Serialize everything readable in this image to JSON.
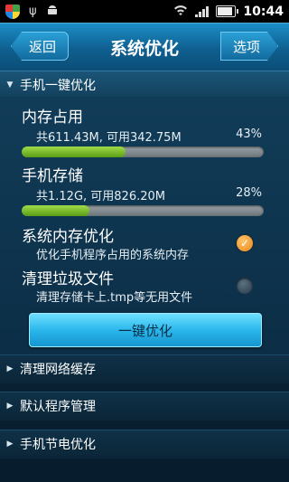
{
  "status_bar": {
    "time": "10:44",
    "icons": [
      "shield-icon",
      "usb-icon",
      "android-icon",
      "wifi-icon",
      "signal-icon",
      "battery-icon"
    ]
  },
  "header": {
    "back_label": "返回",
    "title": "系统优化",
    "options_label": "选项"
  },
  "sections": {
    "one_key": {
      "label": "手机一键优化",
      "expanded": true
    },
    "network_cache": {
      "label": "清理网络缓存"
    },
    "default_programs": {
      "label": "默认程序管理"
    },
    "power_saving": {
      "label": "手机节电优化"
    }
  },
  "memory": {
    "title": "内存占用",
    "detail": "共611.43M, 可用342.75M",
    "percent_text": "43%",
    "usage_fraction": 0.43
  },
  "storage": {
    "title": "手机存储",
    "detail": "共1.12G, 可用826.20M",
    "percent_text": "28%",
    "usage_fraction": 0.28
  },
  "options": {
    "system_memory": {
      "title": "系统内存优化",
      "desc": "优化手机程序占用的系统内存",
      "checked": true
    },
    "clean_junk": {
      "title": "清理垃圾文件",
      "desc": "清理存储卡上.tmp等无用文件",
      "checked": false
    }
  },
  "one_key_button_label": "一键优化",
  "colors": {
    "accent": "#2ab7ec",
    "bar_fill": "#7cc22e",
    "check_on": "#f0952a"
  }
}
